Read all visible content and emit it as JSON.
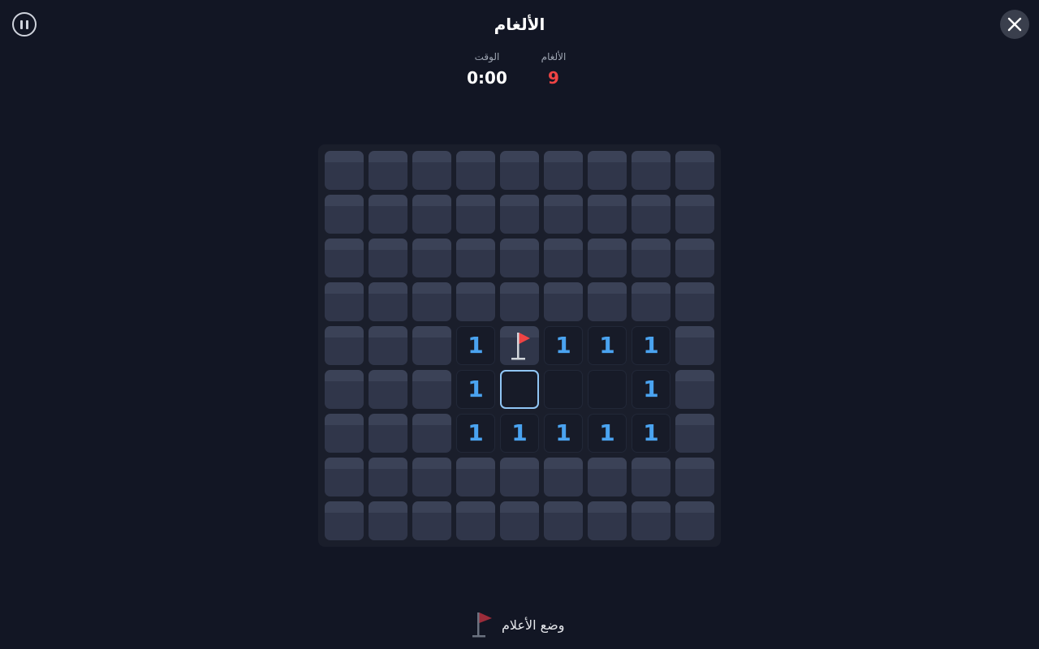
{
  "title": "الألغام",
  "stats": {
    "time_label": "الوقت",
    "time_value": "0:00",
    "mines_label": "الألغام",
    "mines_value": "9"
  },
  "board": {
    "rows": 9,
    "cols": 9,
    "cells": [
      [
        "h",
        "h",
        "h",
        "h",
        "h",
        "h",
        "h",
        "h",
        "h"
      ],
      [
        "h",
        "h",
        "h",
        "h",
        "h",
        "h",
        "h",
        "h",
        "h"
      ],
      [
        "h",
        "h",
        "h",
        "h",
        "h",
        "h",
        "h",
        "h",
        "h"
      ],
      [
        "h",
        "h",
        "h",
        "h",
        "h",
        "h",
        "h",
        "h",
        "h"
      ],
      [
        "h",
        "h",
        "h",
        "1",
        "F",
        "1",
        "1",
        "1",
        "h"
      ],
      [
        "h",
        "h",
        "h",
        "1",
        "0",
        "0",
        "0",
        "1",
        "h"
      ],
      [
        "h",
        "h",
        "h",
        "1",
        "1",
        "1",
        "1",
        "1",
        "h"
      ],
      [
        "h",
        "h",
        "h",
        "h",
        "h",
        "h",
        "h",
        "h",
        "h"
      ],
      [
        "h",
        "h",
        "h",
        "h",
        "h",
        "h",
        "h",
        "h",
        "h"
      ]
    ],
    "selected": [
      5,
      4
    ]
  },
  "flag_mode": {
    "label": "وضع الأعلام"
  },
  "icons": {
    "pause": "pause-icon",
    "close": "close-icon",
    "flag": "flag-icon"
  },
  "colors": {
    "background": "#121624",
    "number": "#4aa3f0",
    "mines_count": "#ef4444",
    "flag": "#ef4444",
    "selected_border": "#90c6f5"
  }
}
